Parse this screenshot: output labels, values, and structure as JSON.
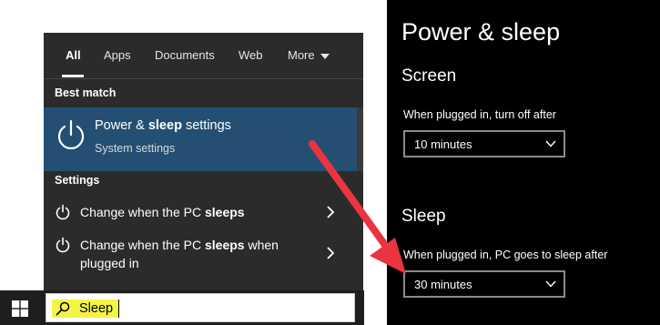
{
  "search_panel": {
    "tabs": [
      {
        "label": "All",
        "active": true
      },
      {
        "label": "Apps"
      },
      {
        "label": "Documents"
      },
      {
        "label": "Web"
      },
      {
        "label": "More"
      }
    ],
    "best_match_header": "Best match",
    "best_match": {
      "title_pre": "Power & ",
      "title_bold": "sleep",
      "title_post": " settings",
      "subtitle": "System settings",
      "icon": "power-icon"
    },
    "settings_header": "Settings",
    "results": [
      {
        "pre": "Change when the PC ",
        "bold": "sleeps",
        "post": "",
        "icon": "power-icon"
      },
      {
        "pre": "Change when the PC ",
        "bold": "sleeps",
        "post": " when plugged in",
        "icon": "power-icon"
      }
    ]
  },
  "taskbar": {
    "search_value": "Sleep",
    "start_icon": "windows-logo-icon",
    "search_icon": "search-icon",
    "highlight_color": "#f4f446"
  },
  "settings_page": {
    "title": "Power & sleep",
    "screen_heading": "Screen",
    "screen_label": "When plugged in, turn off after",
    "screen_value": "10 minutes",
    "sleep_heading": "Sleep",
    "sleep_label": "When plugged in, PC goes to sleep after",
    "sleep_value": "30 minutes"
  },
  "colors": {
    "panel_bg": "#2b2b2b",
    "best_match_bg": "#244f73",
    "settings_bg": "#000000",
    "arrow": "#e8353f"
  }
}
